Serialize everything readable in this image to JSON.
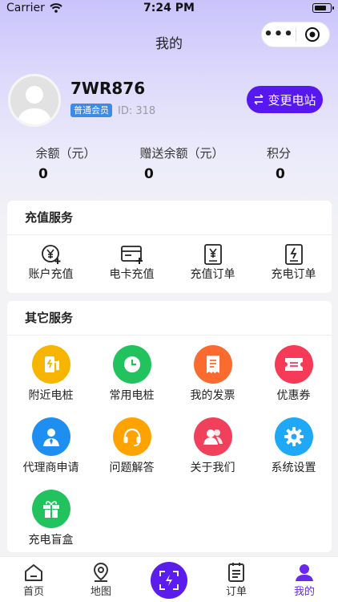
{
  "status": {
    "carrier": "Carrier",
    "time": "7:24 PM"
  },
  "nav": {
    "title": "我的",
    "capsule_more": "•••"
  },
  "user": {
    "name": "7WR876",
    "level": "普通会员",
    "id_label": "ID:",
    "id_value": "318",
    "switch_label": "变更电站"
  },
  "stats": [
    {
      "label": "余额（元）",
      "value": "0"
    },
    {
      "label": "赠送余额（元）",
      "value": "0"
    },
    {
      "label": "积分",
      "value": "0"
    }
  ],
  "recharge": {
    "title": "充值服务",
    "items": [
      {
        "label": "账户充值",
        "icon": "yen-plus-icon"
      },
      {
        "label": "电卡充值",
        "icon": "card-plus-icon"
      },
      {
        "label": "充值订单",
        "icon": "yen-doc-icon"
      },
      {
        "label": "充电订单",
        "icon": "charge-doc-icon"
      }
    ]
  },
  "other": {
    "title": "其它服务",
    "items": [
      {
        "label": "附近电桩",
        "icon": "charging-station-icon",
        "color": "#f7b500"
      },
      {
        "label": "常用电桩",
        "icon": "clock-icon",
        "color": "#22c35e"
      },
      {
        "label": "我的发票",
        "icon": "receipt-icon",
        "color": "#fb6a2e"
      },
      {
        "label": "优惠券",
        "icon": "coupon-icon",
        "color": "#f53b57"
      },
      {
        "label": "代理商申请",
        "icon": "agent-icon",
        "color": "#1e8ff0"
      },
      {
        "label": "问题解答",
        "icon": "headset-icon",
        "color": "#ffa300"
      },
      {
        "label": "关于我们",
        "icon": "users-icon",
        "color": "#f0405b"
      },
      {
        "label": "系统设置",
        "icon": "gear-icon",
        "color": "#1fa8f5"
      },
      {
        "label": "充电盲盒",
        "icon": "gift-icon",
        "color": "#22c35e"
      }
    ]
  },
  "tabs": [
    {
      "label": "首页",
      "icon": "home-icon"
    },
    {
      "label": "地图",
      "icon": "map-pin-icon"
    },
    {
      "label": "",
      "icon": "scan-icon"
    },
    {
      "label": "订单",
      "icon": "order-icon"
    },
    {
      "label": "我的",
      "icon": "user-icon"
    }
  ],
  "colors": {
    "accent": "#5618ee",
    "active_tab": "#6a27ee",
    "badge": "#3d8be6"
  }
}
